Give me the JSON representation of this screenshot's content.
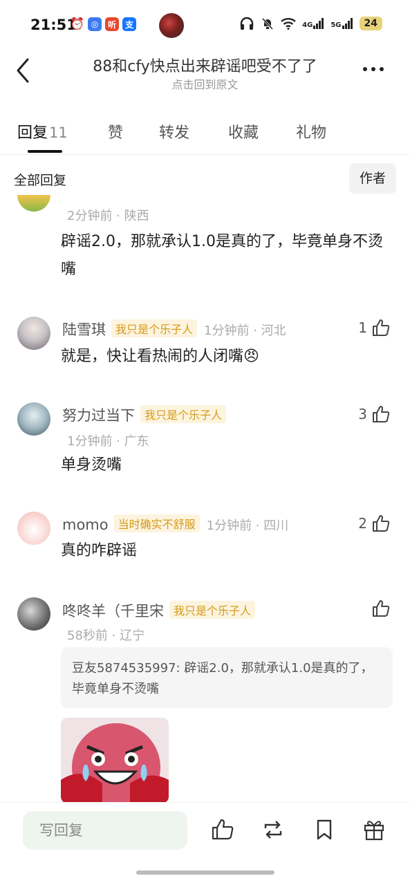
{
  "status_bar": {
    "time": "21:51",
    "app_icons": [
      {
        "name": "alarm-icon",
        "glyph": "⏰",
        "color": "#111111"
      },
      {
        "name": "app-blue-icon",
        "glyph": "◎",
        "color": "#3b7bf0"
      },
      {
        "name": "ting-app-icon",
        "glyph": "听",
        "color": "#e8482e"
      },
      {
        "name": "alipay-icon",
        "glyph": "支",
        "color": "#1677ff"
      }
    ],
    "network_4g": "4G",
    "network_5g": "5G",
    "battery": "24"
  },
  "header": {
    "title": "88和cfy快点出来辟谣吧受不了了",
    "subtitle": "点击回到原文"
  },
  "tabs": [
    {
      "label": "回复",
      "count": "11"
    },
    {
      "label": "赞"
    },
    {
      "label": "转发"
    },
    {
      "label": "收藏"
    },
    {
      "label": "礼物"
    }
  ],
  "filter": {
    "all_label": "全部回复",
    "author_label": "作者"
  },
  "comments": [
    {
      "meta": "2分钟前 · 陕西",
      "text": "辟谣2.0，那就承认1.0是真的了，毕竟单身不烫嘴"
    },
    {
      "name": "陆雪琪",
      "badge": "我只是个乐子人",
      "meta": "1分钟前 · 河北",
      "text": "就是，快让看热闹的人闭嘴",
      "emoji": "😠",
      "likes": "1"
    },
    {
      "name": "努力过当下",
      "badge": "我只是个乐子人",
      "meta": "1分钟前 · 广东",
      "text": "单身烫嘴",
      "likes": "3"
    },
    {
      "name": "momo",
      "badge": "当时确实不舒服",
      "meta": "1分钟前 · 四川",
      "text": "真的咋辟谣",
      "likes": "2"
    },
    {
      "name": "咚咚羊（千里宋",
      "badge": "我只是个乐子人",
      "meta": "58秒前 · 辽宁",
      "quote": "豆友5874535997: 辟谣2.0，那就承认1.0是真的了，毕竟单身不烫嘴"
    }
  ],
  "bottom_bar": {
    "write_placeholder": "写回复"
  },
  "colors": {
    "badge_text": "#d49a1a",
    "badge_bg": "#fdf4df",
    "write_bg": "#eef5ee"
  }
}
